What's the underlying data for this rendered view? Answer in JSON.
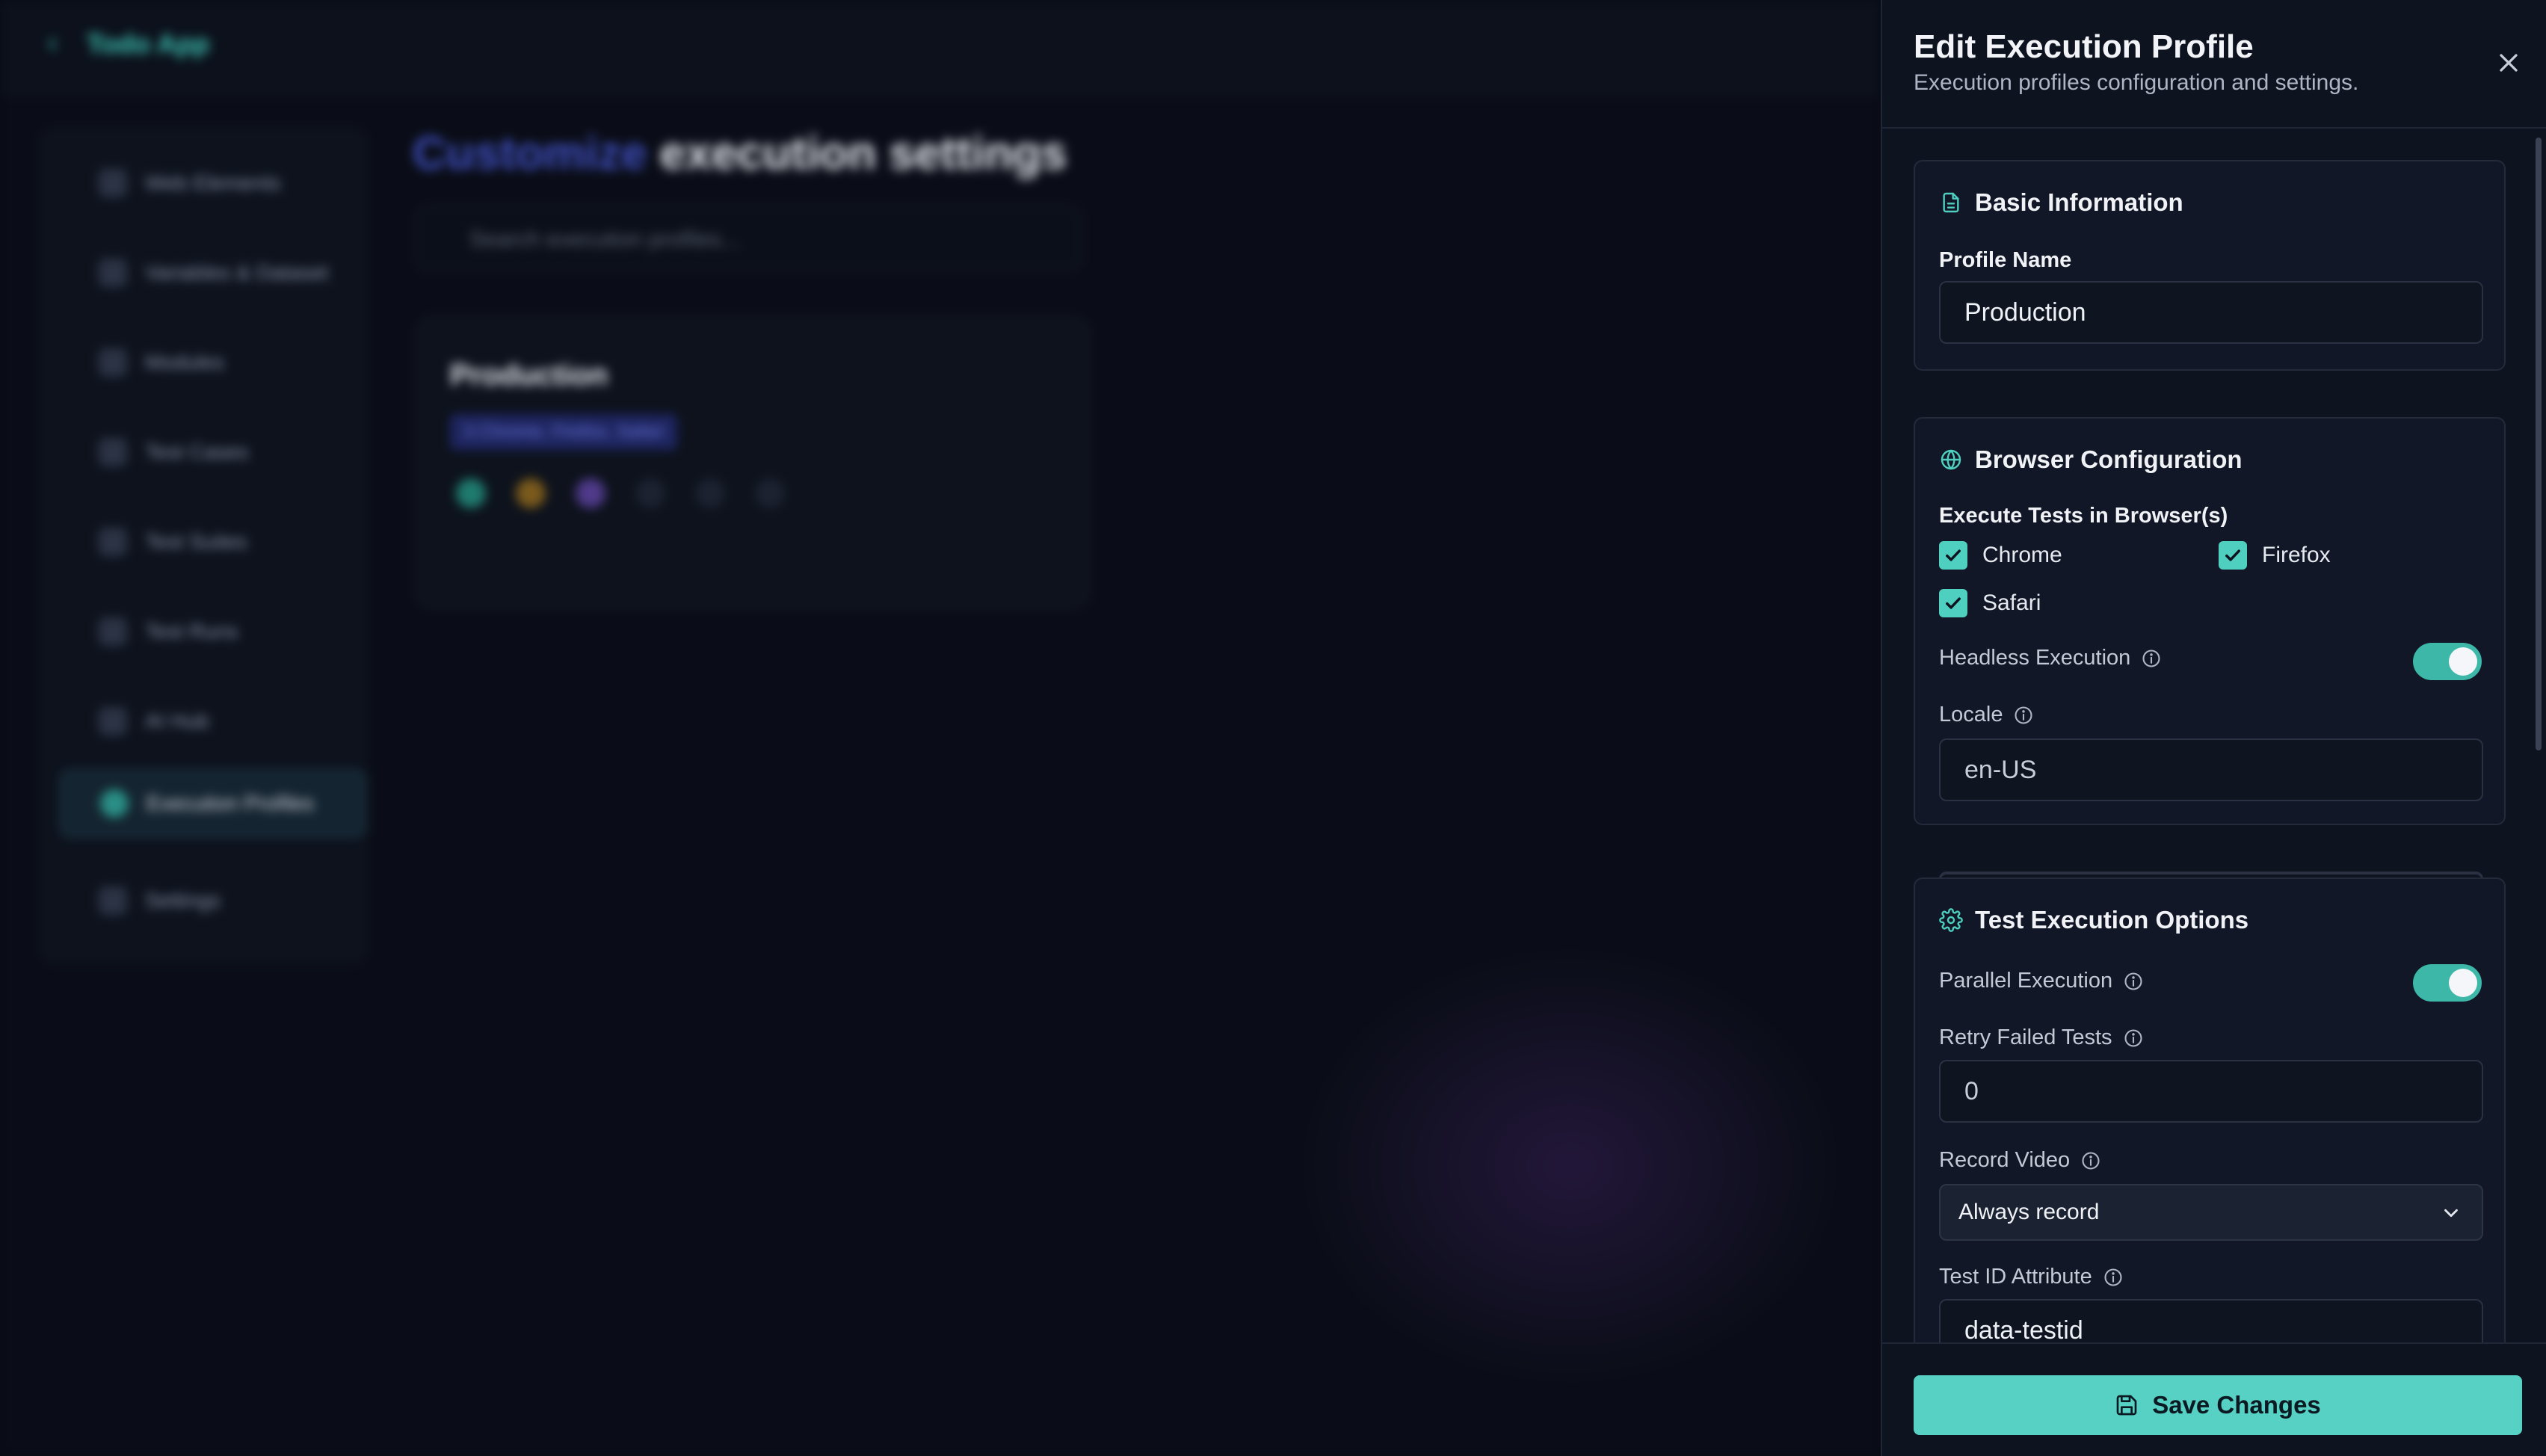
{
  "background": {
    "app_name": "Todo App",
    "nav_items": [
      "Web Elements",
      "Variables & Dataset",
      "Modules",
      "Test Cases",
      "Test Suites",
      "Test Runs",
      "AI Hub",
      "Execution Profiles",
      "Settings"
    ],
    "active_nav": "Execution Profiles",
    "heading_accent": "Customize",
    "heading_rest": "execution settings",
    "search_placeholder": "Search execution profiles...",
    "card_title": "Production",
    "card_tag": "3 Chrome, Firefox, Safari"
  },
  "panel": {
    "title": "Edit Execution Profile",
    "subtitle": "Execution profiles configuration and settings.",
    "basic": {
      "heading": "Basic Information",
      "profile_name_label": "Profile Name",
      "profile_name_value": "Production"
    },
    "browser": {
      "heading": "Browser Configuration",
      "browsers_label": "Execute Tests in Browser(s)",
      "chrome": "Chrome",
      "firefox": "Firefox",
      "safari": "Safari",
      "headless_label": "Headless Execution",
      "locale_label": "Locale",
      "locale_value": "en-US"
    },
    "execution": {
      "heading": "Test Execution Options",
      "parallel_label": "Parallel Execution",
      "retry_label": "Retry Failed Tests",
      "retry_value": "0",
      "record_label": "Record Video",
      "record_value": "Always record",
      "testid_label": "Test ID Attribute",
      "testid_value": "data-testid"
    },
    "save_label": "Save Changes"
  },
  "colors": {
    "accent": "#57d1c4",
    "panel_bg": "#0e1320",
    "section_bg": "#111726"
  }
}
